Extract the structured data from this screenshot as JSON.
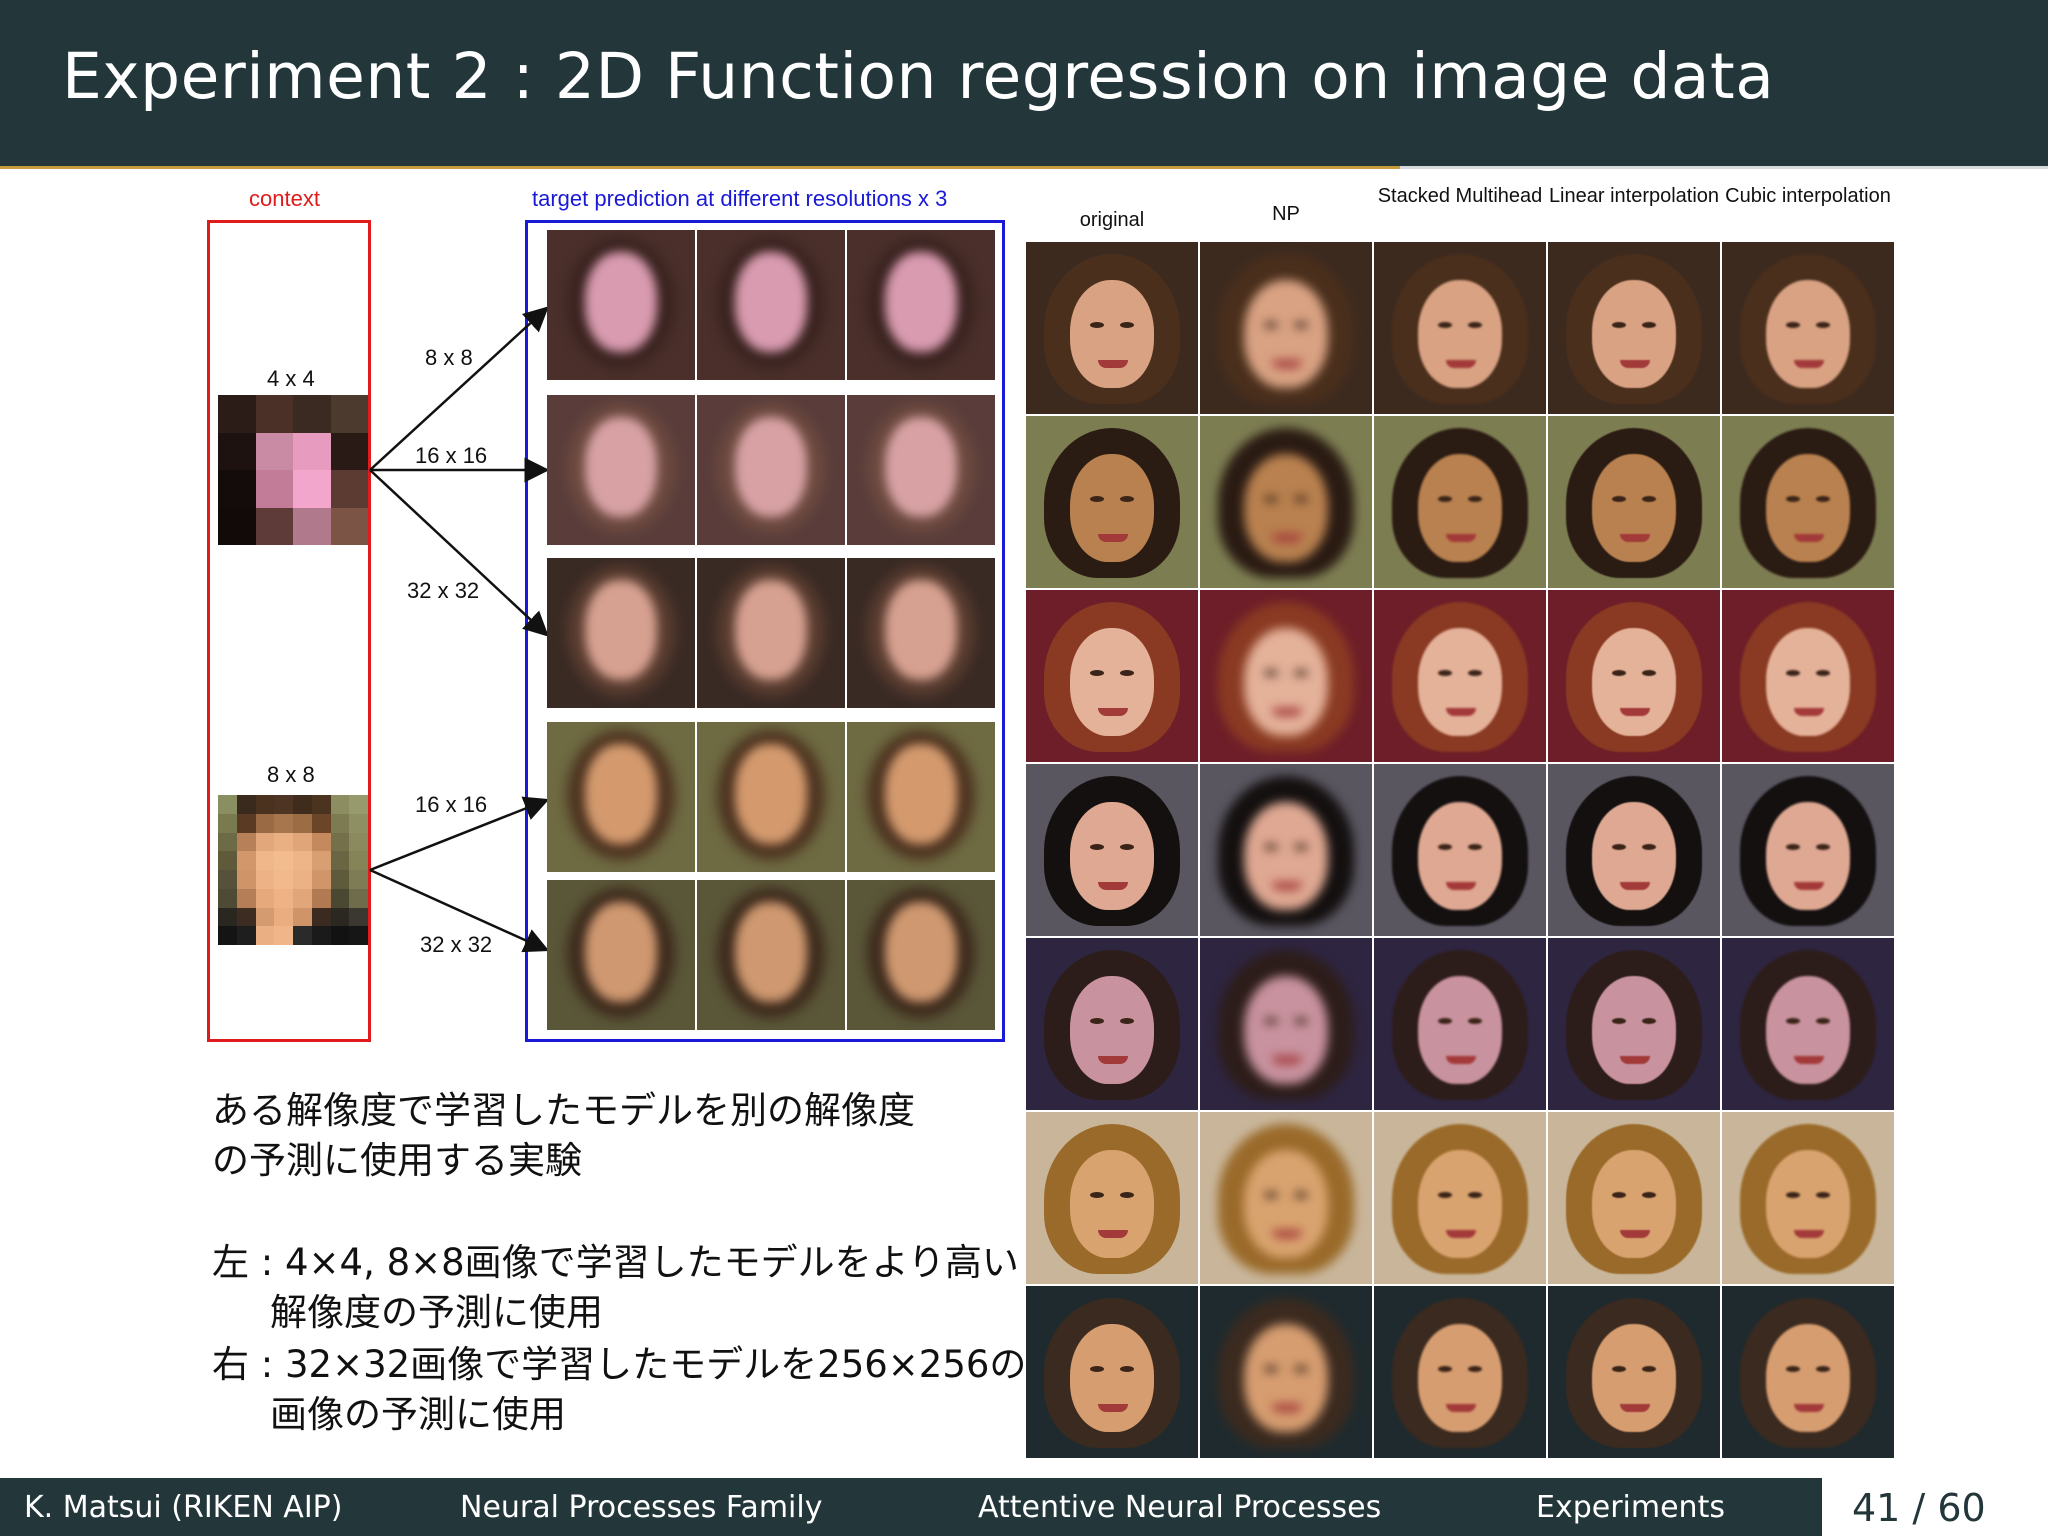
{
  "slide": {
    "title": "Experiment 2 : 2D Function regression on image data"
  },
  "left_figure": {
    "context_label": "context",
    "target_label": "target prediction at different resolutions x 3",
    "context_4x4_label": "4 x 4",
    "context_8x8_label": "8 x 8",
    "arrow_labels": [
      "8 x 8",
      "16 x 16",
      "32 x 32",
      "16 x 16",
      "32 x 32"
    ]
  },
  "right_figure": {
    "columns": [
      "original",
      "NP",
      "Stacked Multihead",
      "Linear interpolation",
      "Cubic interpolation"
    ],
    "rows": 7
  },
  "description": {
    "line1": "ある解像度で学習したモデルを別の解像度",
    "line2": "の予測に使用する実験",
    "left_line1": "左 : 4×4, 8×8画像で学習したモデルをより高い",
    "left_line2": "解像度の予測に使用",
    "right_line1": "右 : 32×32画像で学習したモデルを256×256の",
    "right_line2": "画像の予測に使用"
  },
  "footer": {
    "author": "K. Matsui (RIKEN AIP)",
    "section": "Neural Processes Family",
    "subsection": "Attentive Neural Processes",
    "part": "Experiments",
    "page": "41 / 60"
  }
}
